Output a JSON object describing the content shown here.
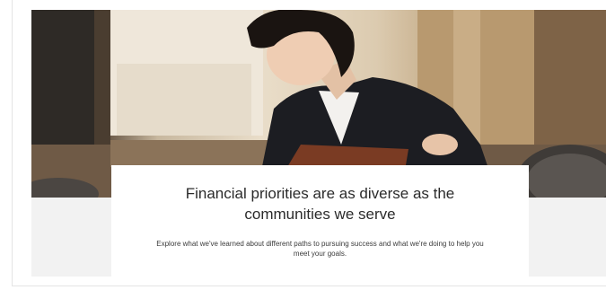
{
  "hero": {
    "image_alt": "Smiling woman in a dark blazer holding a brown folder",
    "headline": "Financial priorities are as diverse as the communities we serve",
    "subtext": "Explore what we've learned about different paths to pursuing success and what we're doing to help you meet your goals."
  },
  "colors": {
    "headline": "#2b2b2b",
    "band": "#f2f2f2",
    "panel": "#ffffff"
  }
}
